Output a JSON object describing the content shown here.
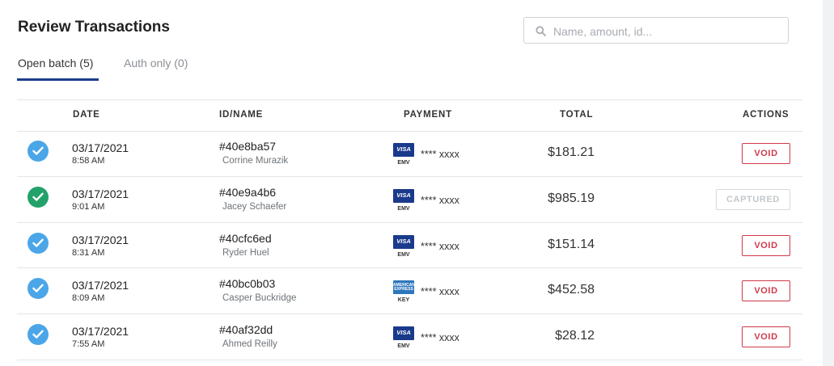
{
  "header": {
    "title": "Review Transactions"
  },
  "search": {
    "placeholder": "Name, amount, id...",
    "icon": "search-icon"
  },
  "tabs": [
    {
      "label": "Open batch (5)",
      "active": true
    },
    {
      "label": "Auth only (0)",
      "active": false
    }
  ],
  "table": {
    "columns": [
      "DATE",
      "ID/NAME",
      "PAYMENT",
      "TOTAL",
      "ACTIONS"
    ],
    "rows": [
      {
        "status": "check-blue",
        "date": "03/17/2021",
        "time": "8:58 AM",
        "id": "#40e8ba57",
        "name": "Corrine Murazik",
        "card": "VISA",
        "entry": "EMV",
        "masked": "**** xxxx",
        "total": "$181.21",
        "action": "VOID"
      },
      {
        "status": "check-green",
        "date": "03/17/2021",
        "time": "9:01 AM",
        "id": "#40e9a4b6",
        "name": "Jacey Schaefer",
        "card": "VISA",
        "entry": "EMV",
        "masked": "**** xxxx",
        "total": "$985.19",
        "action": "CAPTURED"
      },
      {
        "status": "check-blue",
        "date": "03/17/2021",
        "time": "8:31 AM",
        "id": "#40cfc6ed",
        "name": "Ryder Huel",
        "card": "VISA",
        "entry": "EMV",
        "masked": "**** xxxx",
        "total": "$151.14",
        "action": "VOID"
      },
      {
        "status": "check-blue",
        "date": "03/17/2021",
        "time": "8:09 AM",
        "id": "#40bc0b03",
        "name": "Casper Buckridge",
        "card": "AMERICAN EXPRESS",
        "entry": "KEY",
        "masked": "**** xxxx",
        "total": "$452.58",
        "action": "VOID"
      },
      {
        "status": "check-blue",
        "date": "03/17/2021",
        "time": "7:55 AM",
        "id": "#40af32dd",
        "name": "Ahmed Reilly",
        "card": "VISA",
        "entry": "EMV",
        "masked": "**** xxxx",
        "total": "$28.12",
        "action": "VOID"
      }
    ]
  },
  "colors": {
    "accent": "#1d3e8a",
    "check_blue": "#4ba6e8",
    "check_green": "#22a26a",
    "void_red": "#d0394b",
    "visa_blue": "#1a3a8c",
    "amex_blue": "#2e77bc"
  }
}
